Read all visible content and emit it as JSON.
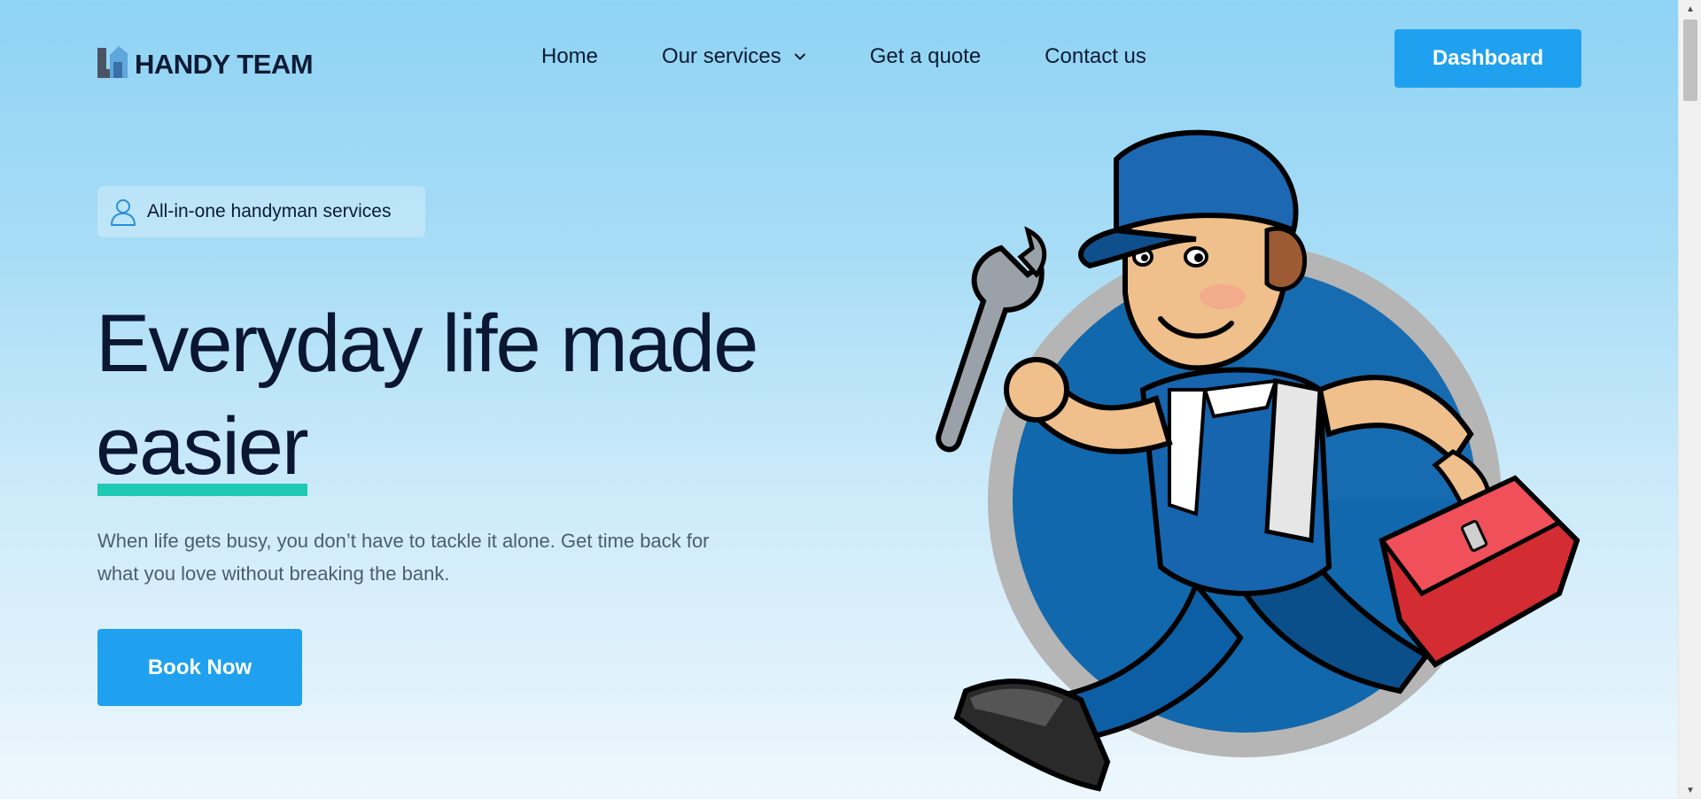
{
  "header": {
    "logo_text": "HANDY TEAM",
    "nav": [
      {
        "label": "Home"
      },
      {
        "label": "Our services",
        "has_dropdown": true
      },
      {
        "label": "Get a quote"
      },
      {
        "label": "Contact us"
      }
    ],
    "dashboard_label": "Dashboard"
  },
  "hero": {
    "badge": {
      "icon": "user-icon",
      "label": "All-in-one handyman services"
    },
    "headline_line1": "Everyday life made",
    "headline_line2": "easier",
    "subtext": "When life gets busy, you don’t have to tackle it alone. Get time back for what you love without breaking the bank.",
    "cta_label": "Book Now",
    "illustration": "handyman-mascot-illustration"
  },
  "colors": {
    "accent_blue": "#1fa1ef",
    "underline_teal": "#1fcab3",
    "heading": "#0a1632",
    "body_text": "#4c5d72"
  }
}
